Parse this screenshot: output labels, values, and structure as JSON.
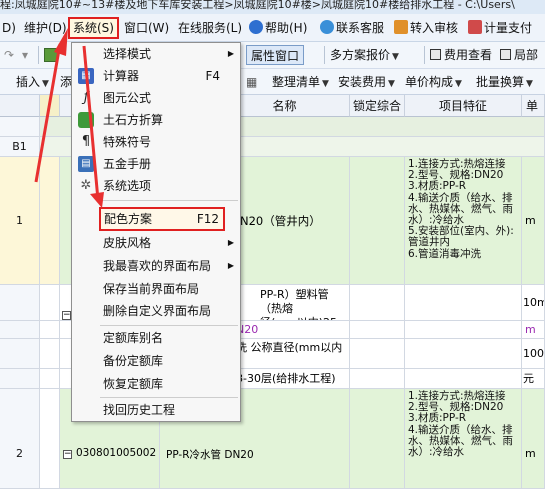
{
  "titlebar": {
    "text": "程:凤城庭院10#~13#楼及地下车库安装工程>凤城庭院10#楼>凤城庭院10#楼给排水工程 - C:\\Users\\"
  },
  "menubar": {
    "items": [
      "D)",
      "维护(D)",
      "系统(S)",
      "窗口(W)",
      "在线服务(L)",
      "帮助(H)",
      "联系客服",
      "转入审核",
      "计量支付"
    ]
  },
  "toolbar1": {
    "attr_window": "属性窗口",
    "multi_quote": "多方案报价",
    "fee_view": "费用查看",
    "local_label": "局部"
  },
  "toolbar2": {
    "insert": "插入",
    "add_short": "添",
    "tidy_list": "整理清单",
    "install_fee": "安装费用",
    "unit_price": "单价构成",
    "batch_convert": "批量换算"
  },
  "grid": {
    "headers": {
      "name": "名称",
      "locked": "锁定综合",
      "feature": "项目特征",
      "unit_short": "单位"
    },
    "rows": [
      {
        "num": "",
        "code": "",
        "name": "",
        "feature": "",
        "unit": ""
      },
      {
        "num": "B1",
        "code": "",
        "name": "",
        "feature": "",
        "unit": ""
      },
      {
        "num": "1",
        "code": "",
        "name": "N20（管井内）",
        "feature": "1.连接方式:热熔连接\n2.型号、规格:DN20\n3.材质:PP-R\n4.输送介质（给水、排水、热媒体、燃气、雨水）:冷给水\n5.安装部位(室内、外):管道井内\n6.管道消毒冲洗",
        "unit": "m"
      },
      {
        "num": "",
        "code": "",
        "name": "PP-R）塑料管（热熔\n径(mm以内)25 人工乘",
        "feature": "",
        "unit": "10m"
      },
      {
        "num": "",
        "code": "",
        "name": "N20",
        "feature": "",
        "unit": "m"
      },
      {
        "num": "",
        "code": "",
        "name": "洗 公称直径(mm以内",
        "feature": "",
        "unit": "100m"
      },
      {
        "num": "",
        "code": "",
        "name": "8-30层(给排水工程)",
        "feature": "",
        "unit": "元"
      },
      {
        "num": "2",
        "code": "030801005002",
        "name": "PP-R冷水管 DN20",
        "feature": "1.连接方式:热熔连接\n2.型号、规格:DN20\n3.材质:PP-R\n4.输送介质（给水、排水、热媒体、燃气、雨水）:冷给水",
        "unit": "m"
      }
    ]
  },
  "system_menu": {
    "items": [
      {
        "label": "选择模式",
        "shortcut": "",
        "submenu": true,
        "icon": ""
      },
      {
        "label": "计算器",
        "shortcut": "F4",
        "submenu": false,
        "icon": "calculator-icon"
      },
      {
        "label": "图元公式",
        "shortcut": "",
        "submenu": false,
        "icon": "formula-icon"
      },
      {
        "label": "土石方折算",
        "shortcut": "",
        "submenu": false,
        "icon": "cube-icon"
      },
      {
        "label": "特殊符号",
        "shortcut": "",
        "submenu": false,
        "icon": "pilcrow-icon"
      },
      {
        "label": "五金手册",
        "shortcut": "",
        "submenu": false,
        "icon": "book-icon"
      },
      {
        "label": "系统选项",
        "shortcut": "",
        "submenu": false,
        "icon": "tools-icon"
      },
      {
        "label": "配色方案",
        "shortcut": "F12",
        "submenu": false,
        "icon": ""
      },
      {
        "label": "皮肤风格",
        "shortcut": "",
        "submenu": true,
        "icon": ""
      },
      {
        "label": "我最喜欢的界面布局",
        "shortcut": "",
        "submenu": true,
        "icon": ""
      },
      {
        "label": "保存当前界面布局",
        "shortcut": "",
        "submenu": false,
        "icon": ""
      },
      {
        "label": "删除自定义界面布局",
        "shortcut": "",
        "submenu": false,
        "icon": ""
      },
      {
        "label": "定额库别名",
        "shortcut": "",
        "submenu": false,
        "icon": ""
      },
      {
        "label": "备份定额库",
        "shortcut": "",
        "submenu": false,
        "icon": ""
      },
      {
        "label": "恢复定额库",
        "shortcut": "",
        "submenu": false,
        "icon": ""
      },
      {
        "label": "找回历史工程",
        "shortcut": "",
        "submenu": false,
        "icon": ""
      }
    ]
  },
  "colors": {
    "highlight": "#e02020",
    "row_green": "#e2f3d8",
    "arrow": "#e83030"
  }
}
